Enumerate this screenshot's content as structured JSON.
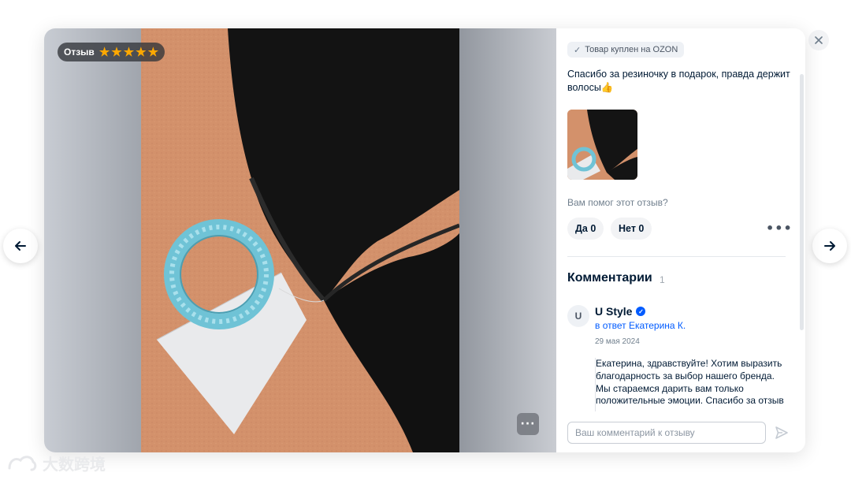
{
  "rating": {
    "label": "Отзыв",
    "stars": 5
  },
  "badge": {
    "text": "Товар куплен на OZON"
  },
  "review": {
    "text": "Спасибо за резиночку в подарок, правда держит волосы👍"
  },
  "helpful": {
    "question": "Вам помог этот отзыв?",
    "yes_label": "Да 0",
    "no_label": "Нет 0"
  },
  "comments": {
    "title": "Комментарии",
    "count": "1",
    "items": [
      {
        "avatar_initial": "U",
        "author": "U Style",
        "reply_to": "в ответ Екатерина К.",
        "date": "29 мая 2024",
        "text": "Екатерина, здравствуйте! Хотим выразить благодарность за выбор нашего бренда. Мы стараемся дарить вам только положительные эмоции. Спасибо за отзыв"
      }
    ],
    "input_placeholder": "Ваш комментарий к отзыву"
  },
  "watermark": {
    "text": "大数跨境"
  },
  "colors": {
    "accent": "#005bff",
    "star": "#ffa800",
    "text": "#001a34",
    "muted": "#707f8d"
  },
  "icons": {
    "prev": "arrow-left-icon",
    "next": "arrow-right-icon",
    "close": "close-icon",
    "send": "send-icon",
    "check": "check-icon",
    "verified": "verified-icon",
    "more": "more-dots-icon"
  }
}
